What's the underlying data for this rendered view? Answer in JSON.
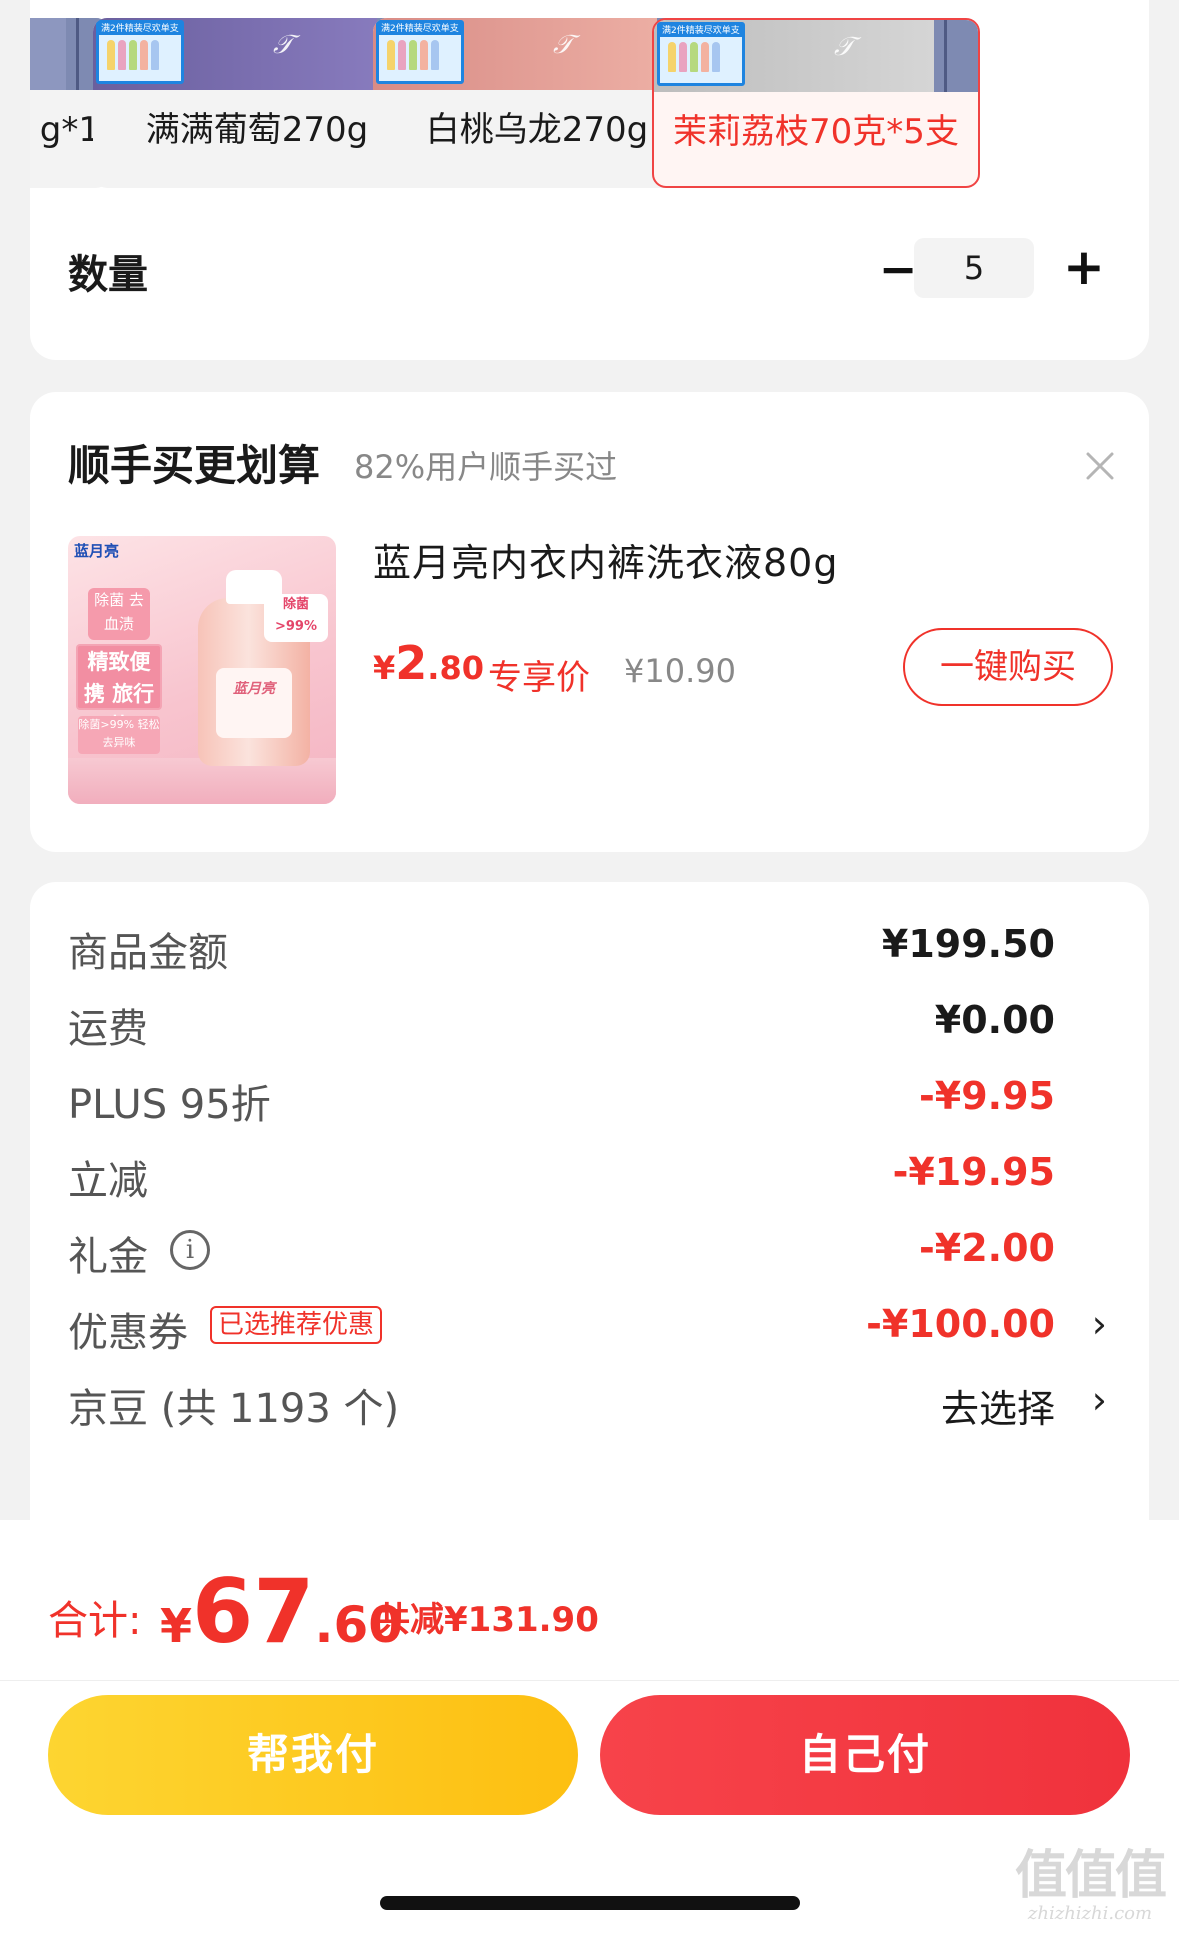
{
  "variants": [
    {
      "label": "g*1"
    },
    {
      "label": "满满葡萄270g"
    },
    {
      "label": "白桃乌龙270g"
    },
    {
      "label": "茉莉荔枝70克*5支",
      "selected": true
    }
  ],
  "thumb_promo_text": "满2件精装尽欢单支",
  "quantity": {
    "label": "数量",
    "minus": "−",
    "value": "5",
    "plus": "+"
  },
  "addon": {
    "title": "顺手买更划算",
    "subtitle": "82%用户顺手买过",
    "close_icon": "close-icon",
    "product": {
      "name": "蓝月亮内衣内裤洗衣液80g",
      "price_currency": "¥",
      "price_int": "2",
      "price_dec": ".80",
      "price_label": "专享价",
      "original_price": "¥10.90",
      "buy_button": "一键购买",
      "image_texts": {
        "logo": "蓝月亮",
        "tag1": "除菌 去血渍",
        "tag2": "精致便携 旅行装",
        "tag3": "除菌>99% 轻松去异味",
        "badge": "除菌 >99%",
        "bottle": "蓝月亮"
      }
    }
  },
  "summary": [
    {
      "label": "商品金额",
      "value": "¥199.50",
      "style": "normal"
    },
    {
      "label": "运费",
      "value": "¥0.00",
      "style": "normal"
    },
    {
      "label": "PLUS 95折",
      "value": "-¥9.95",
      "style": "red"
    },
    {
      "label": "立减",
      "value": "-¥19.95",
      "style": "red"
    },
    {
      "label": "礼金",
      "value": "-¥2.00",
      "style": "red",
      "icon": "info-icon",
      "icon_glyph": "i"
    },
    {
      "label": "优惠券",
      "tag": "已选推荐优惠",
      "value": "-¥100.00",
      "style": "red",
      "chevron": "›"
    },
    {
      "label": "京豆 (共 1193 个)",
      "value": "去选择",
      "style": "plain",
      "chevron": "›"
    }
  ],
  "total": {
    "label": "合计:",
    "currency": "¥",
    "int": "67",
    "dec": ".60",
    "saving": "共减¥131.90"
  },
  "buttons": {
    "help_pay": "帮我付",
    "self_pay": "自己付"
  },
  "watermark": {
    "big": "值值值",
    "small": "zhizhizhi.com"
  },
  "colors": {
    "accent_red": "#f0322a",
    "help_yellow": "#fdc91f",
    "self_red": "#f33a42"
  }
}
